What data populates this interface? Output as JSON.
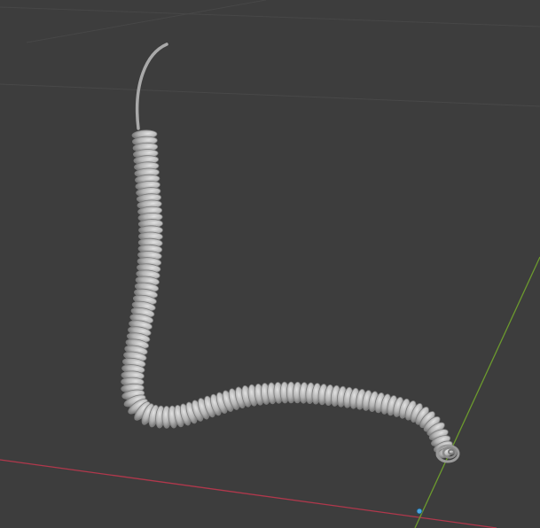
{
  "viewport": {
    "background_color": "#3d3d3d",
    "grid_line_color": "#4a4a4a",
    "x_axis_color": "#b1384c",
    "y_axis_color": "#6c9a2e",
    "origin_marker_color": "#4aa3e0"
  },
  "object": {
    "type": "coiled-cable-mesh",
    "shading": "solid-gray",
    "coil_color": "#b9b9b9",
    "coil_highlight": "#dcdcdc",
    "coil_shadow": "#7c7c7c",
    "tail_color": "#a9a9a9"
  }
}
